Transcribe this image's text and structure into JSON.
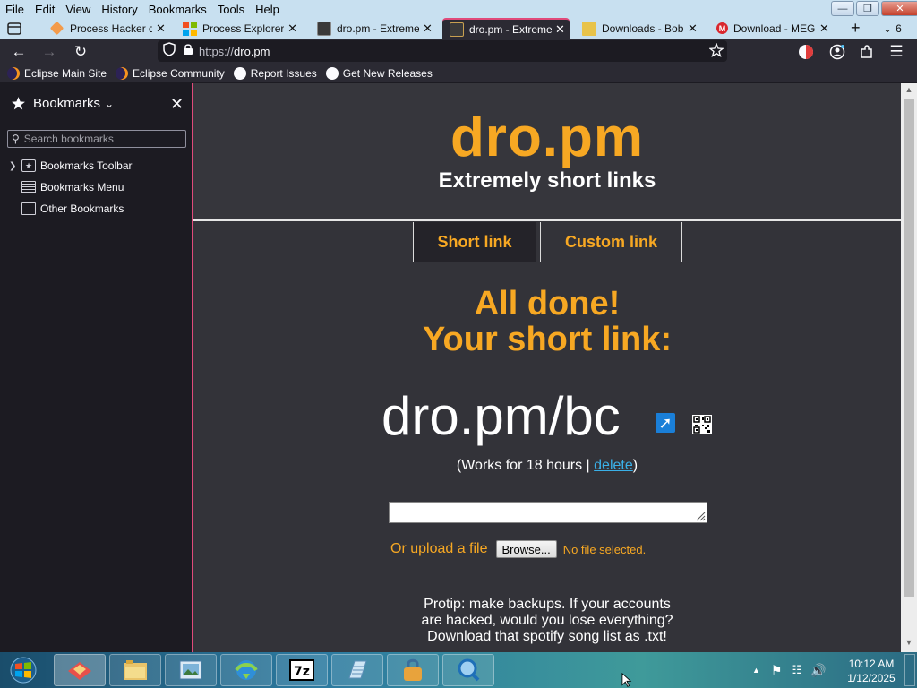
{
  "menubar": {
    "items": [
      "File",
      "Edit",
      "View",
      "History",
      "Bookmarks",
      "Tools",
      "Help"
    ]
  },
  "tabs": [
    {
      "label": "Process Hacker d",
      "icon": "process-hacker-icon",
      "active": false
    },
    {
      "label": "Process Explorer -",
      "icon": "windows-icon",
      "active": false
    },
    {
      "label": "dro.pm - Extreme",
      "icon": "dropm-favicon",
      "active": false
    },
    {
      "label": "dro.pm - Extreme",
      "icon": "dropm-favicon",
      "active": true
    },
    {
      "label": "Downloads - Bob",
      "icon": "folder-favicon",
      "active": false
    },
    {
      "label": "Download - MEG",
      "icon": "mega-icon",
      "active": false
    }
  ],
  "tab_count_label": "6",
  "navbar": {
    "url_scheme": "https://",
    "url_host": "dro.pm"
  },
  "bookmarks_toolbar": [
    {
      "label": "Eclipse Main Site",
      "icon": "eclipse-icon"
    },
    {
      "label": "Eclipse Community",
      "icon": "eclipse-icon"
    },
    {
      "label": "Report Issues",
      "icon": "github-icon"
    },
    {
      "label": "Get New Releases",
      "icon": "github-icon"
    }
  ],
  "sidebar": {
    "title": "Bookmarks",
    "search_placeholder": "Search bookmarks",
    "items": [
      {
        "label": "Bookmarks Toolbar",
        "icon": "star-toolbar-icon",
        "expandable": true
      },
      {
        "label": "Bookmarks Menu",
        "icon": "menu-list-icon",
        "expandable": false
      },
      {
        "label": "Other Bookmarks",
        "icon": "folder-icon",
        "expandable": false
      }
    ]
  },
  "page": {
    "logo": "dro.pm",
    "tagline": "Extremely short links",
    "tab_short": "Short link",
    "tab_custom": "Custom link",
    "done_line1": "All done!",
    "done_line2": "Your short link:",
    "short_link": "dro.pm/bc",
    "works_prefix": "(Works for 18 hours | ",
    "delete_label": "delete",
    "works_suffix": ")",
    "upload_label": "Or upload a file",
    "browse_label": "Browse...",
    "no_file_label": "No file selected.",
    "protip_line1": "Protip: make backups. If your accounts",
    "protip_line2": "are hacked, would you lose everything?",
    "protip_line3": "Download that spotify song list as .txt!"
  },
  "colors": {
    "accent_orange": "#f7a823",
    "link_blue": "#3ab0e8",
    "active_tab_border": "#e04a7a"
  },
  "taskbar": {
    "apps": [
      "firefox-icon",
      "file-explorer-icon",
      "photo-viewer-icon",
      "idm-icon",
      "7zip-icon",
      "notepad-icon",
      "lock-bag-icon",
      "magnifier-icon"
    ],
    "time": "10:12 AM",
    "date": "1/12/2025"
  }
}
